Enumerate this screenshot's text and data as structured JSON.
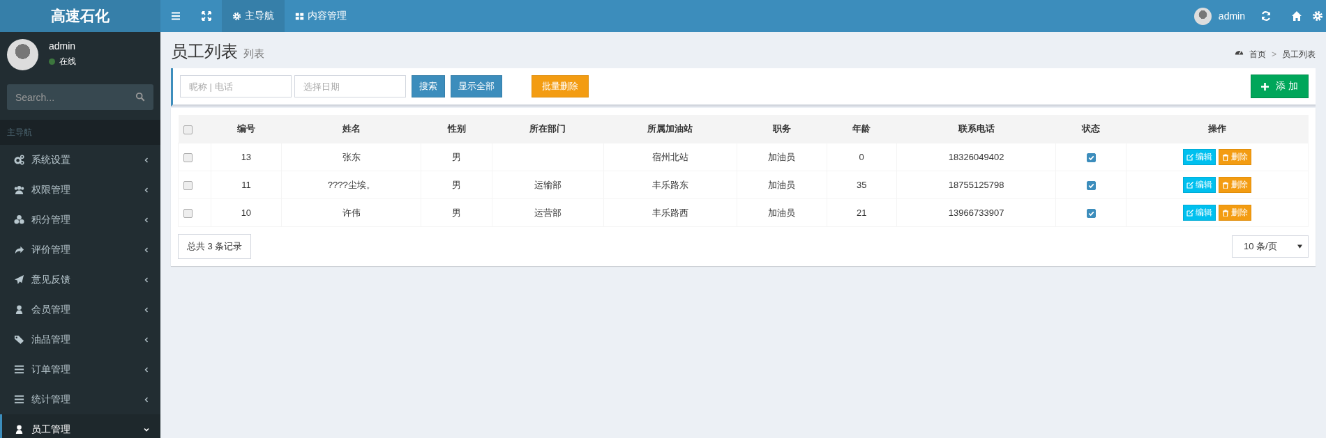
{
  "header": {
    "logo": "高速石化",
    "nav_tabs": [
      {
        "label": "主导航",
        "selected": true
      },
      {
        "label": "内容管理",
        "selected": false
      }
    ],
    "user": "admin"
  },
  "sidebar": {
    "user": {
      "name": "admin",
      "status": "在线"
    },
    "search": {
      "placeholder": "Search..."
    },
    "section": "主导航",
    "items": [
      {
        "label": "系统设置",
        "expanded": false,
        "selected": false
      },
      {
        "label": "权限管理",
        "expanded": false,
        "selected": false
      },
      {
        "label": "积分管理",
        "expanded": false,
        "selected": false
      },
      {
        "label": "评价管理",
        "expanded": false,
        "selected": false
      },
      {
        "label": "意见反馈",
        "expanded": false,
        "selected": false
      },
      {
        "label": "会员管理",
        "expanded": false,
        "selected": false
      },
      {
        "label": "油品管理",
        "expanded": false,
        "selected": false
      },
      {
        "label": "订单管理",
        "expanded": false,
        "selected": false
      },
      {
        "label": "统计管理",
        "expanded": false,
        "selected": false
      },
      {
        "label": "员工管理",
        "expanded": true,
        "selected": true
      }
    ]
  },
  "page": {
    "title": "员工列表",
    "subtitle": "列表",
    "breadcrumb": [
      "首页",
      "员工列表"
    ],
    "breadcrumb_separator": ">"
  },
  "filters": {
    "keyword": {
      "placeholder": "昵称 | 电话"
    },
    "date": {
      "placeholder": "选择日期"
    },
    "buttons": [
      {
        "label": "搜索",
        "kind": "primary"
      },
      {
        "label": "显示全部",
        "kind": "primary"
      },
      {
        "label": "批量删除",
        "kind": "warning"
      }
    ],
    "add_button": "添 加"
  },
  "table": {
    "all_checked": false,
    "columns": [
      "编号",
      "姓名",
      "性别",
      "所在部门",
      "所属加油站",
      "职务",
      "年龄",
      "联系电话",
      "状态",
      "操作"
    ],
    "rows": [
      {
        "checked": false,
        "cells": [
          "13",
          "张东",
          "男",
          "",
          "宿州北站",
          "加油员",
          "0",
          "18326049402"
        ],
        "status": true,
        "actions": [
          "编辑",
          "删除"
        ]
      },
      {
        "checked": false,
        "cells": [
          "11",
          "????尘埃。",
          "男",
          "运输部",
          "丰乐路东",
          "加油员",
          "35",
          "18755125798"
        ],
        "status": true,
        "actions": [
          "编辑",
          "删除"
        ]
      },
      {
        "checked": false,
        "cells": [
          "10",
          "许伟",
          "男",
          "运营部",
          "丰乐路西",
          "加油员",
          "21",
          "13966733907"
        ],
        "status": true,
        "actions": [
          "编辑",
          "删除"
        ]
      }
    ]
  },
  "footer": {
    "total": "总共 3 条记录",
    "page_size": "10 条/页"
  }
}
